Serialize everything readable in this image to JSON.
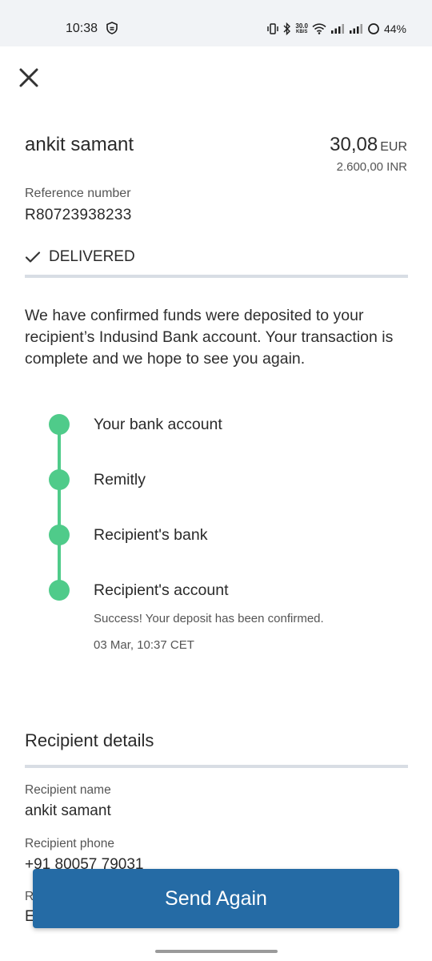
{
  "status_bar": {
    "time": "10:38",
    "net_speed_top": "30.0",
    "net_speed_bottom": "KB/S",
    "battery": "44%"
  },
  "header": {
    "close_icon": "close-icon"
  },
  "transfer": {
    "recipient": "ankit samant",
    "amount_value": "30,08",
    "amount_currency": "EUR",
    "amount_received": "2.600,00 INR",
    "reference_label": "Reference number",
    "reference_value": "R80723938233",
    "status": "DELIVERED",
    "message": "We have confirmed funds were deposited to your recipient’s Indusind Bank account. Your transaction is complete and we hope to see you again."
  },
  "timeline": {
    "color": "#4fcb8a",
    "steps": [
      {
        "label": "Your bank account"
      },
      {
        "label": "Remitly"
      },
      {
        "label": "Recipient's bank"
      },
      {
        "label": "Recipient's account"
      }
    ],
    "success_note": "Success! Your deposit has been confirmed.",
    "timestamp": "03 Mar, 10:37 CET"
  },
  "recipient_details": {
    "title": "Recipient details",
    "name_label": "Recipient name",
    "name_value": "ankit samant",
    "phone_label": "Recipient phone",
    "phone_value": "+91 80057 79031",
    "partial_label": "R",
    "partial_value": "E"
  },
  "actions": {
    "send_again": "Send Again",
    "button_color": "#256ba5"
  }
}
